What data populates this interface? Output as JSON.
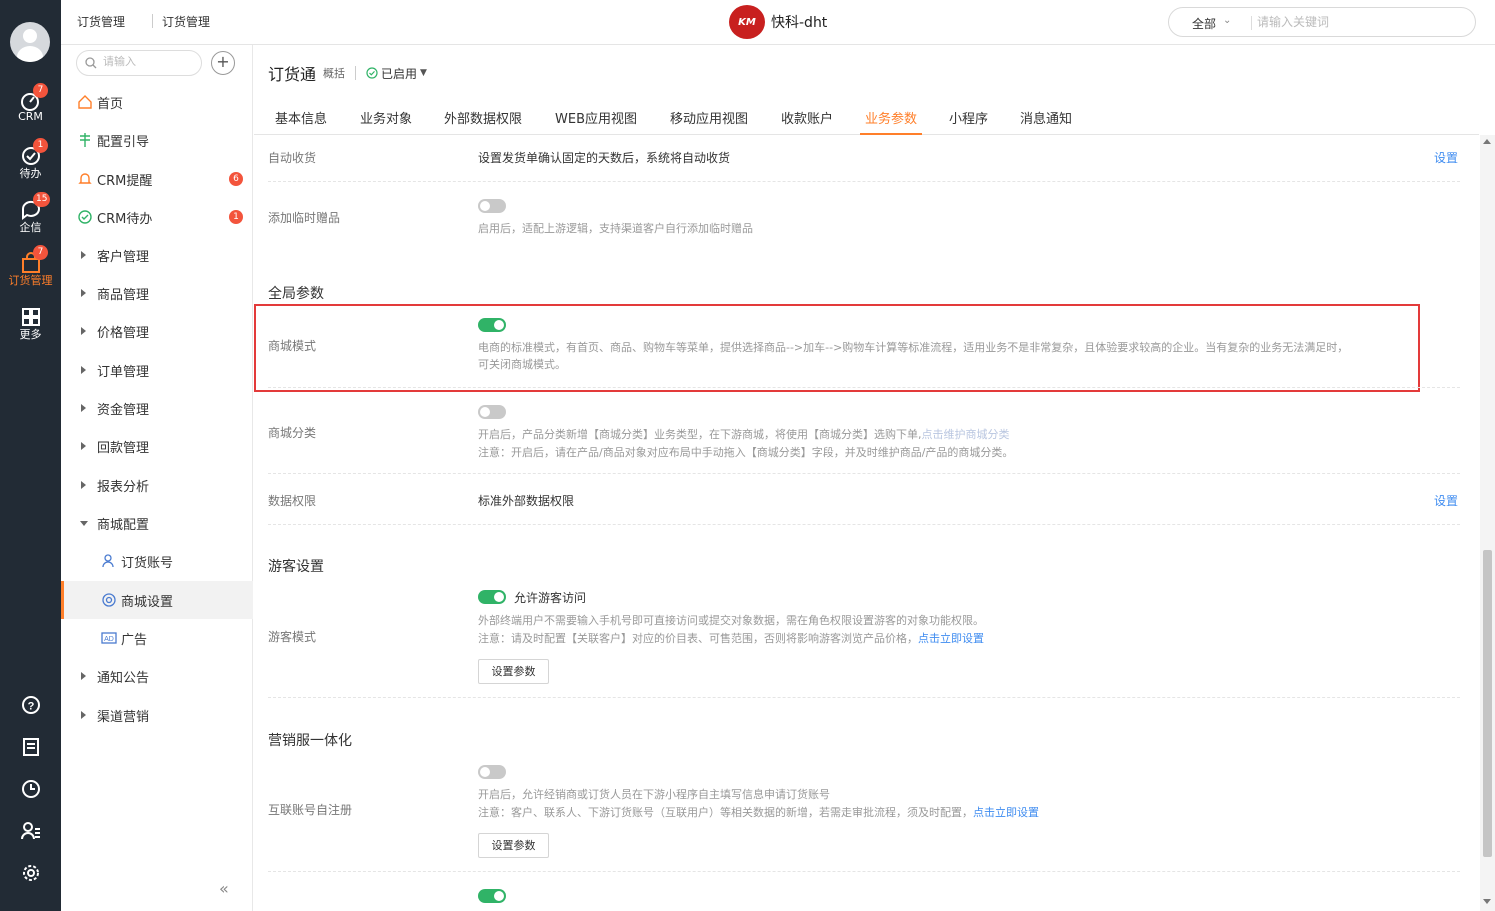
{
  "rail": {
    "items": [
      {
        "label": "CRM",
        "badge": "7"
      },
      {
        "label": "待办",
        "badge": "1"
      },
      {
        "label": "企信",
        "badge": "15"
      },
      {
        "label": "订货管理",
        "badge": "7"
      },
      {
        "label": "更多",
        "badge": ""
      }
    ],
    "accent": "#ff7f2a"
  },
  "topbar": {
    "breadcrumb": [
      "订货管理",
      "订货管理"
    ],
    "logo_mark": "KM",
    "logo_text": "快科-dht",
    "search_scope": "全部",
    "search_placeholder": "请输入关键词"
  },
  "menu": {
    "search_placeholder": "请输入",
    "items": [
      {
        "label": "首页",
        "icon": "home-icon"
      },
      {
        "label": "配置引导",
        "icon": "guide-icon"
      },
      {
        "label": "CRM提醒",
        "icon": "bell-icon",
        "badge": "6"
      },
      {
        "label": "CRM待办",
        "icon": "check-circle-icon",
        "badge": "1"
      },
      {
        "label": "客户管理"
      },
      {
        "label": "商品管理"
      },
      {
        "label": "价格管理"
      },
      {
        "label": "订单管理"
      },
      {
        "label": "资金管理"
      },
      {
        "label": "回款管理"
      },
      {
        "label": "报表分析"
      },
      {
        "label": "商城配置"
      },
      {
        "label": "订货账号",
        "icon": "account-icon"
      },
      {
        "label": "商城设置",
        "icon": "settings-circle-icon"
      },
      {
        "label": "广告",
        "icon": "ad-icon"
      },
      {
        "label": "通知公告"
      },
      {
        "label": "渠道营销"
      }
    ]
  },
  "page": {
    "title": "订货通",
    "subtitle": "概括",
    "status": "已启用",
    "tabs": [
      "基本信息",
      "业务对象",
      "外部数据权限",
      "WEB应用视图",
      "移动应用视图",
      "收款账户",
      "业务参数",
      "小程序",
      "消息通知"
    ],
    "active_tab": "业务参数"
  },
  "settings": {
    "auto_receive": {
      "label": "自动收货",
      "text": "设置发货单确认固定的天数后，系统将自动收货",
      "link": "设置"
    },
    "temp_gift": {
      "label": "添加临时赠品",
      "desc": "启用后，适配上游逻辑，支持渠道客户自行添加临时赠品"
    },
    "global_title": "全局参数",
    "mall_mode": {
      "label": "商城模式",
      "desc1": "电商的标准模式，有首页、商品、购物车等菜单，提供选择商品-->加车-->购物车计算等标准流程，适用业务不是非常复杂，且体验要求较高的企业。当有复杂的业务无法满足时，",
      "desc2": "可关闭商城模式。"
    },
    "mall_category": {
      "label": "商城分类",
      "desc1": "开启后，产品分类新增【商城分类】业务类型，在下游商城，将使用【商城分类】选购下单,",
      "desc1_link": "点击维护商城分类",
      "desc2": "注意：开启后，请在产品/商品对象对应布局中手动拖入【商城分类】字段，并及时维护商品/产品的商城分类。"
    },
    "data_perm": {
      "label": "数据权限",
      "text": "标准外部数据权限",
      "link": "设置"
    },
    "guest_title": "游客设置",
    "guest_mode": {
      "label": "游客模式",
      "toggle_label": "允许游客访问",
      "desc1": "外部终端用户不需要输入手机号即可直接访问或提交对象数据，需在角色权限设置游客的对象功能权限。",
      "desc2": "注意：请及时配置【关联客户】对应的价目表、可售范围，否则将影响游客浏览产品价格，",
      "desc2_link": "点击立即设置",
      "button": "设置参数"
    },
    "marketing_title": "营销服一体化",
    "interconnect": {
      "label": "互联账号自注册",
      "desc1": "开启后，允许经销商或订货人员在下游小程序自主填写信息申请订货账号",
      "desc2": "注意：客户、联系人、下游订货账号（互联用户）等相关数据的新增，若需走审批流程，须及时配置，",
      "desc2_link": "点击立即设置",
      "button": "设置参数"
    }
  }
}
